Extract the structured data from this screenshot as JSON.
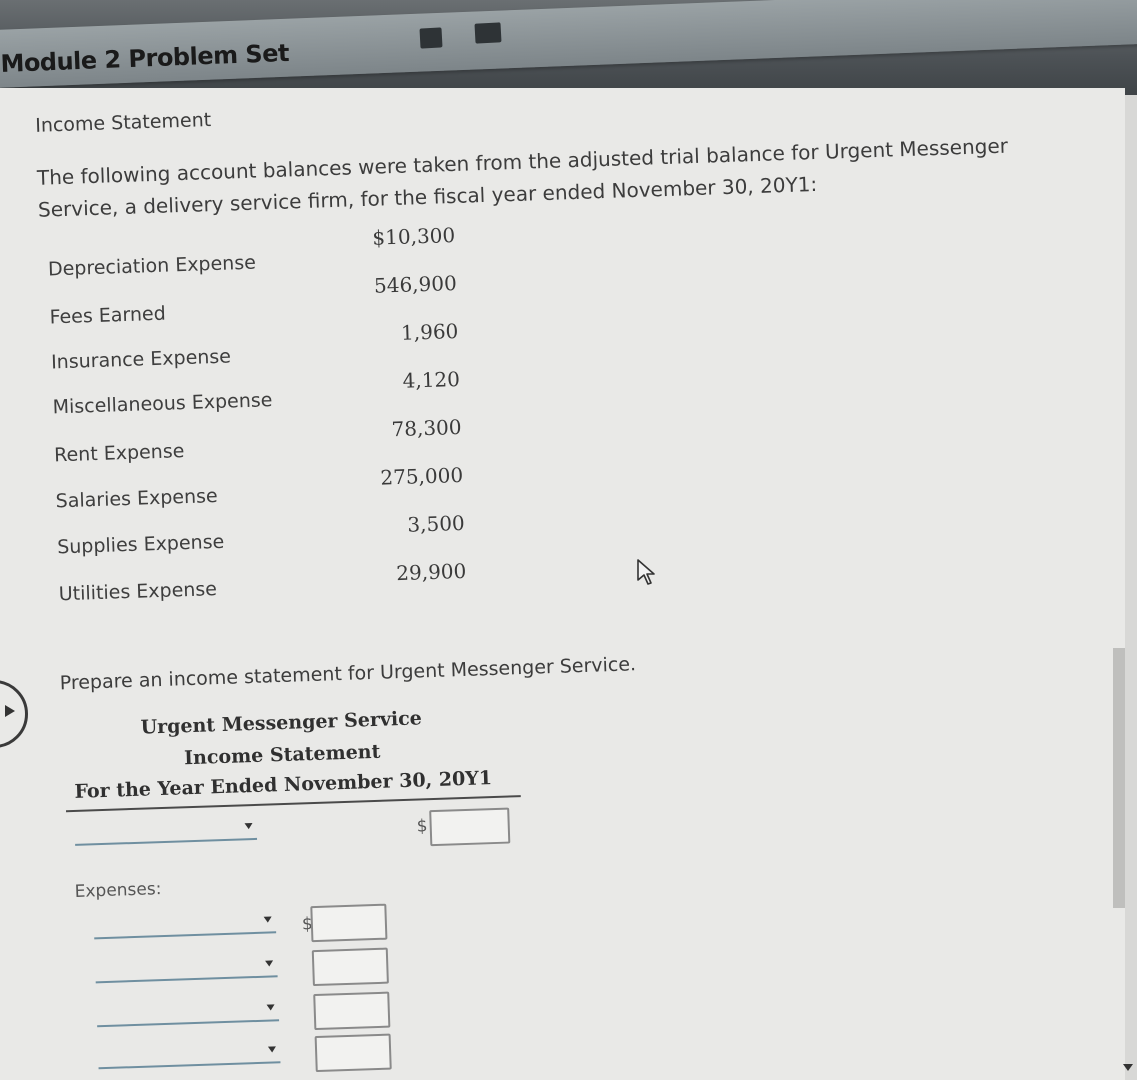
{
  "module": {
    "title": "Module 2 Problem Set"
  },
  "header_icons": [
    "bookmark-icon",
    "video-icon"
  ],
  "section_label": "Income Statement",
  "intro": {
    "line1": "The following account balances were taken from the adjusted trial balance for Urgent Messenger",
    "line2": "Service, a delivery service firm, for the fiscal year ended November 30, 20Y1:"
  },
  "accounts": [
    {
      "name": "Depreciation Expense",
      "value": "$10,300"
    },
    {
      "name": "Fees Earned",
      "value": "546,900"
    },
    {
      "name": "Insurance Expense",
      "value": "1,960"
    },
    {
      "name": "Miscellaneous Expense",
      "value": "4,120"
    },
    {
      "name": "Rent Expense",
      "value": "78,300"
    },
    {
      "name": "Salaries Expense",
      "value": "275,000"
    },
    {
      "name": "Supplies Expense",
      "value": "3,500"
    },
    {
      "name": "Utilities Expense",
      "value": "29,900"
    }
  ],
  "instruction": "Prepare an income statement for Urgent Messenger Service.",
  "statement": {
    "company": "Urgent Messenger Service",
    "title": "Income Statement",
    "period": "For the Year Ended November 30, 20Y1",
    "revenue_dropdown_value": "",
    "revenue_amount": "",
    "currency_symbol": "$",
    "expenses_label": "Expenses:",
    "expense_rows": [
      {
        "dropdown_value": "",
        "amount": "",
        "show_dollar": true
      },
      {
        "dropdown_value": "",
        "amount": "",
        "show_dollar": false
      },
      {
        "dropdown_value": "",
        "amount": "",
        "show_dollar": false
      },
      {
        "dropdown_value": "",
        "amount": "",
        "show_dollar": false
      }
    ]
  }
}
